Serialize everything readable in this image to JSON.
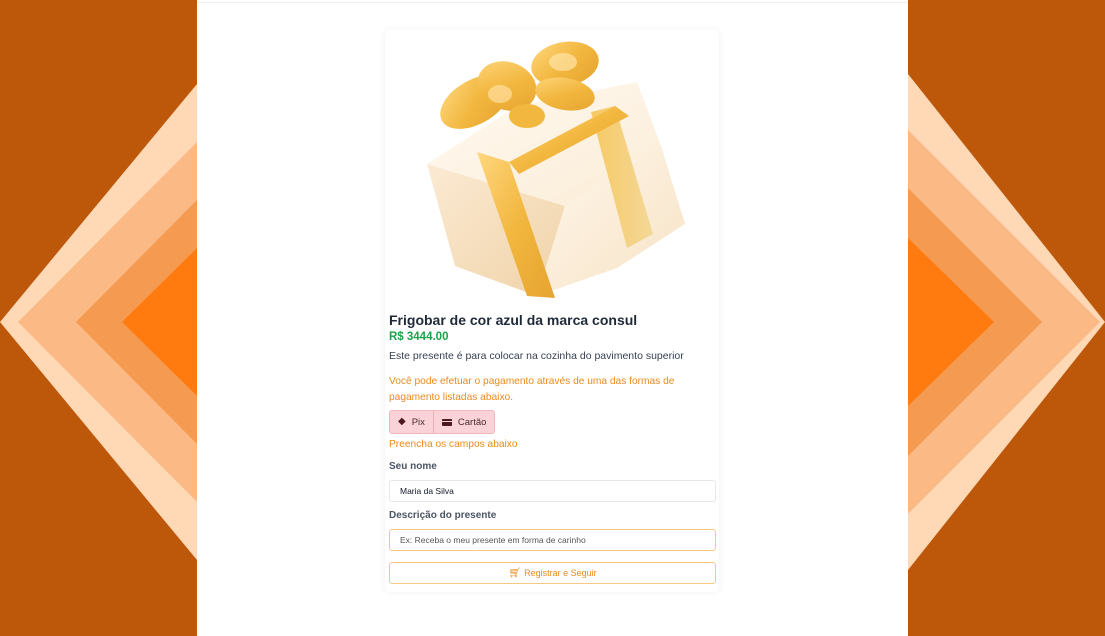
{
  "product": {
    "title": "Frigobar de cor azul da marca consul",
    "price": "R$ 3444.00",
    "description": "Este presente é para colocar na cozinha do pavimento superior"
  },
  "payment": {
    "info": "Você pode efetuar o pagamento através de uma das formas de pagamento listadas abaixo.",
    "methods": [
      {
        "label": "Pix",
        "icon": "pix-icon"
      },
      {
        "label": "Cartão",
        "icon": "credit-card-icon"
      }
    ]
  },
  "form": {
    "instruction": "Preencha os campos abaixo",
    "name_label": "Seu nome",
    "name_value": "Maria da Silva",
    "description_label": "Descrição do presente",
    "description_placeholder": "Ex: Receba o meu presente em forma de carinho",
    "submit_label": "Registrar e Seguir",
    "submit_icon": "shopping-cart-icon"
  },
  "colors": {
    "background": "#bd580b",
    "accent": "#ea8a1c",
    "price": "#1aa34a",
    "payment_tab_bg": "#f9d3d7"
  }
}
